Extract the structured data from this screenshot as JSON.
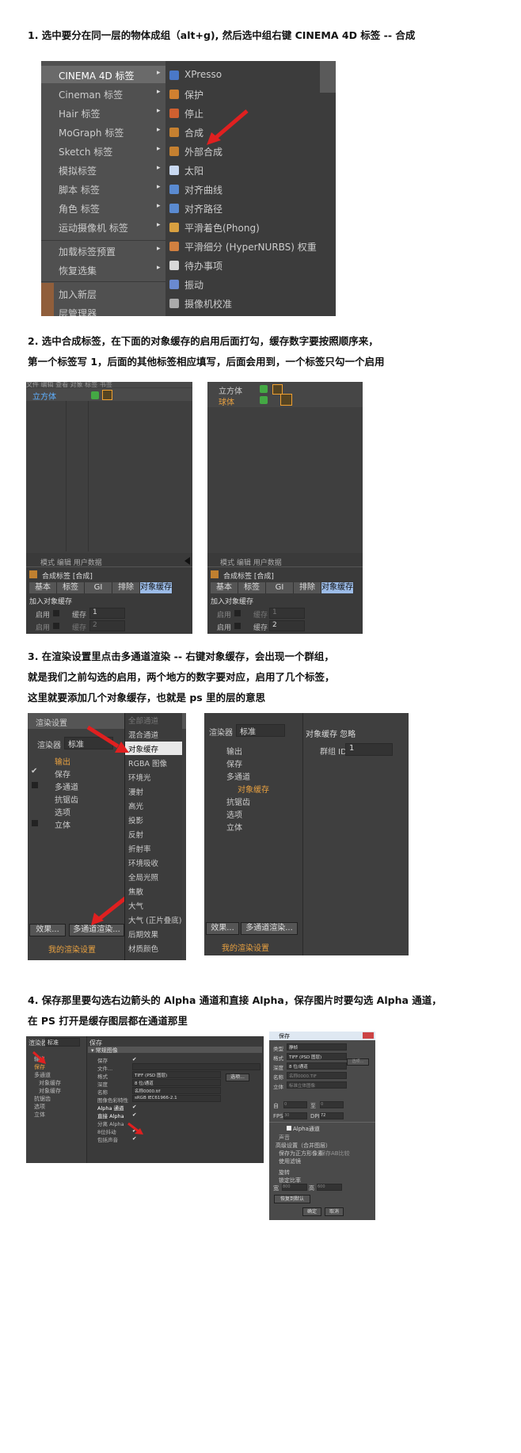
{
  "steps": {
    "s1": "1. 选中要分在同一层的物体成组（alt+g), 然后选中组右键 CINEMA 4D 标签 -- 合成",
    "s2a": "2. 选中合成标签，在下面的对象缓存的启用后面打勾，缓存数字要按照顺序来，",
    "s2b": "第一个标签写 1，后面的其他标签相应填写，后面会用到，一个标签只勾一个启用",
    "s3a": "3. 在渲染设置里点击多通道渲染 -- 右键对象缓存，会出现一个群组，",
    "s3b": "就是我们之前勾选的启用，两个地方的数字要对应，启用了几个标签，",
    "s3c": "这里就要添加几个对象缓存，也就是 ps 里的层的意思",
    "s4a": "4. 保存那里要勾选右边箭头的 Alpha 通道和直接 Alpha，保存图片时要勾选 Alpha 通道，",
    "s4b": "在 PS 打开是缓存图层都在通道那里"
  },
  "menu": {
    "left": [
      "CINEMA 4D 标签",
      "Cineman 标签",
      "Hair 标签",
      "MoGraph 标签",
      "Sketch 标签",
      "模拟标签",
      "脚本 标签",
      "角色 标签",
      "运动摄像机 标签",
      "加载标签预置",
      "恢复选集",
      "加入新层",
      "层管理器"
    ],
    "right": [
      "XPresso",
      "保护",
      "停止",
      "合成",
      "外部合成",
      "太阳",
      "对齐曲线",
      "对齐路径",
      "平滑着色(Phong)",
      "平滑细分 (HyperNURBS) 权重",
      "待办事项",
      "振动",
      "摄像机校准"
    ]
  },
  "obj1": {
    "menubar": "文件  编辑  查看  对象  标签  书签",
    "object": "立方体",
    "attr_menu": "模式   编辑   用户数据",
    "tag_name": "合成标签 [合成]",
    "tabs": [
      "基本",
      "标签",
      "GI",
      "排除",
      "对象缓存"
    ],
    "section": "加入对象缓存",
    "enable": "启用",
    "cache": "缓存",
    "v1": "1",
    "v2": "2"
  },
  "obj2": {
    "objects": [
      "立方体",
      "球体"
    ],
    "attr_menu": "模式   编辑   用户数据",
    "tag_name": "合成标签 [合成]",
    "tabs": [
      "基本",
      "标签",
      "GI",
      "排除",
      "对象缓存"
    ],
    "section": "加入对象缓存",
    "enable": "启用",
    "cache": "缓存",
    "v1": "1",
    "v2": "2"
  },
  "render1": {
    "title": "渲染设置",
    "renderer_label": "渲染器",
    "renderer_value": "标准",
    "tree": [
      "输出",
      "保存",
      "多通道",
      "抗锯齿",
      "选项",
      "立体"
    ],
    "buttons": [
      "效果...",
      "多通道渲染..."
    ],
    "preset": "我的渲染设置",
    "popup": [
      "全部通道",
      "混合通道",
      "对象缓存",
      "RGBA 图像",
      "环境光",
      "漫射",
      "高光",
      "投影",
      "反射",
      "折射率",
      "环境吸收",
      "全局光照",
      "焦散",
      "大气",
      "大气 (正片叠底)",
      "后期效果",
      "材质颜色"
    ]
  },
  "render2": {
    "renderer_label": "渲染器",
    "renderer_value": "标准",
    "tree": [
      "输出",
      "保存",
      "多通道",
      "对象缓存",
      "抗锯齿",
      "选项",
      "立体"
    ],
    "buttons": [
      "效果...",
      "多通道渲染..."
    ],
    "preset": "我的渲染设置",
    "right_title": "对象缓存  忽略",
    "group_label": "群组 ID",
    "group_value": "1"
  },
  "save1": {
    "renderer_label": "渲染器",
    "renderer_value": "标准",
    "tree": [
      "输出",
      "保存",
      "多通道",
      "对象缓存",
      "对象缓存",
      "抗锯齿",
      "选项",
      "立体"
    ],
    "header": "保存",
    "section": "▾ 常规图像",
    "rows": [
      {
        "label": "保存",
        "value": "✔"
      },
      {
        "label": "文件...",
        "value": ""
      },
      {
        "label": "格式",
        "value": "TIFF (PSD 图层)"
      },
      {
        "label": "深度",
        "value": "8 位/通道"
      },
      {
        "label": "名称",
        "value": "名称0000.tif"
      },
      {
        "label": "图像色彩特性",
        "value": "sRGB IEC61966-2.1"
      },
      {
        "label": "Alpha 通道",
        "value": "✔"
      },
      {
        "label": "直接 Alpha",
        "value": "✔"
      },
      {
        "label": "分离 Alpha",
        "value": ""
      },
      {
        "label": "8位抖动",
        "value": "✔"
      },
      {
        "label": "包括声音",
        "value": "✔"
      }
    ],
    "options_btn": "选项..."
  },
  "save2": {
    "title": "保存",
    "rows": [
      {
        "label": "类型",
        "value": "静帧"
      },
      {
        "label": "格式",
        "value": "TIFF (PSD 图层)"
      },
      {
        "label": "深度",
        "value": "8 位/通道"
      },
      {
        "label": "名称",
        "value": "名称0000.TIF"
      },
      {
        "label": "立体",
        "value": "标准立体图像"
      }
    ],
    "from": "自",
    "to": "至",
    "from_v": "0",
    "to_v": "0",
    "fps": "FPS",
    "fps_v": "30",
    "dpi": "DPI",
    "dpi_v": "72",
    "alpha": "Alpha通道",
    "sound": "声音",
    "adv": "高级设置（合并图层）",
    "adv1": "保存为正方形像素",
    "adv2": "保存AB比较",
    "adv3": "使用滤镜",
    "rot": "旋转",
    "lock": "锁定比率",
    "w": "宽",
    "w_v": "800",
    "h": "高",
    "h_v": "600",
    "reset": "恢复到默认",
    "ok": "确定",
    "cancel": "取消",
    "opt": "选项..."
  }
}
